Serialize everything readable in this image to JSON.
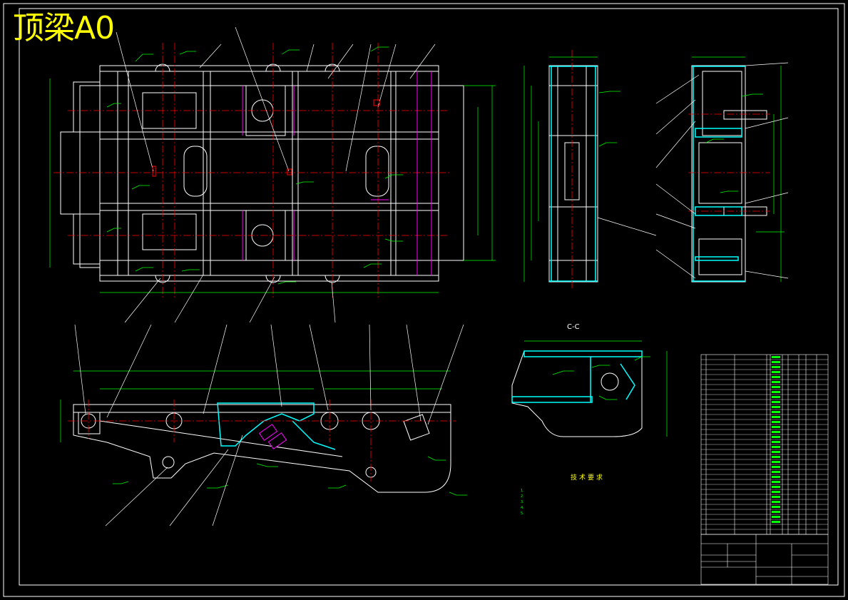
{
  "drawing": {
    "title": "顶梁A0",
    "section_label": "C-C",
    "tech_title": "技术要求",
    "tech_notes": [
      "1.",
      "2.",
      "3.",
      "4.",
      "5."
    ]
  },
  "colors": {
    "background": "#000000",
    "outline": "#ffffff",
    "dimension": "#00ff00",
    "centerline": "#ff0000",
    "hatch": "#00ffff",
    "hidden": "#ff00ff",
    "title": "#ffff00"
  },
  "title_block": {
    "parts_rows": 36
  }
}
